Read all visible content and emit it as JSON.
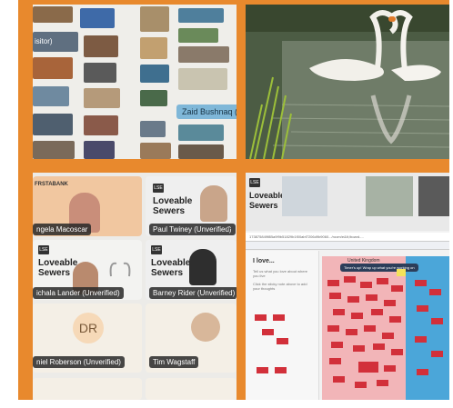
{
  "gallery": {
    "name_tag": "Zaid Bushnaq (Visito",
    "side_label": "isitor)"
  },
  "meeting": {
    "tiles": [
      {
        "name": "ngela Macoscar"
      },
      {
        "name": "Paul Twiney (Unverified)",
        "menu": "···"
      },
      {
        "name": "ichala Lander (Unverified)"
      },
      {
        "name": "Barney Rider (Unverified)"
      },
      {
        "name": "niel Roberson (Unverified)",
        "initials": "DR"
      },
      {
        "name": "Tim Wagstaff"
      }
    ],
    "logo_word1": "Loveable",
    "logo_word2": "Sewers",
    "badge_text": "FRSTABANK",
    "logo_square": "LSE"
  },
  "whiteboard": {
    "logo_word1": "Loveable",
    "logo_word2": "Sewers",
    "sidebar_title": "I love...",
    "sidebar_hint": "Tell us what you love about where you live",
    "sidebar_hint2": "Click the sticky note above to add your thoughts",
    "column_header": "United Kingdom",
    "banner_text": "Timer's up! Wrap up what you're working on",
    "url_text": "173875849f8Ba9f9b51829b1f00abf7206d9b9060.../room/e&lt;/board-..."
  },
  "colors": {
    "frame": "#e8892d",
    "sticky_red": "#d2303a",
    "board_pink": "#f2b5b8",
    "board_blue": "#4ba6d9",
    "tag_bg": "#2b2b2b"
  }
}
